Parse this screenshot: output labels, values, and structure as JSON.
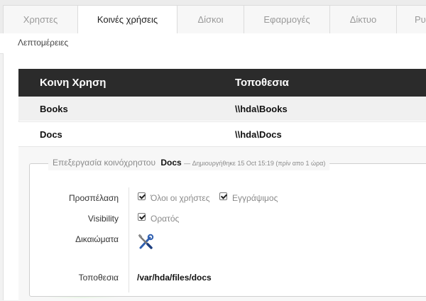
{
  "tabs": [
    {
      "label": "Χρηστες",
      "active": false
    },
    {
      "label": "Κοινές χρήσεις",
      "active": true
    },
    {
      "label": "Δίσκοι",
      "active": false
    },
    {
      "label": "Εφαρμογές",
      "active": false
    },
    {
      "label": "Δίκτυο",
      "active": false
    },
    {
      "label": "Ρυ",
      "active": false
    }
  ],
  "subbar": {
    "link": "Λεπτομέρειες"
  },
  "table": {
    "headers": [
      "Κοινη Χρηση",
      "Τοποθεσια"
    ],
    "rows": [
      {
        "name": "Books",
        "location": "\\\\hda\\Books"
      },
      {
        "name": "Docs",
        "location": "\\\\hda\\Docs"
      }
    ]
  },
  "editor": {
    "legend_prefix": "Επεξεργασία κοινόχρηστου",
    "share_name": "Docs",
    "created": "— Δημιουργήθηκε 15 Oct 15:19 (πρίν απο 1 ώρα)",
    "access_label": "Προσπέλαση",
    "access_all": "Όλοι οι χρήστες",
    "access_write": "Εγγράψιμος",
    "visibility_label": "Visibility",
    "visible": "Ορατός",
    "permissions_label": "Δικαιώματα",
    "location_label": "Τοποθεσια",
    "location_value": "/var/hda/files/docs",
    "permissions_icon": "tools-icon"
  }
}
